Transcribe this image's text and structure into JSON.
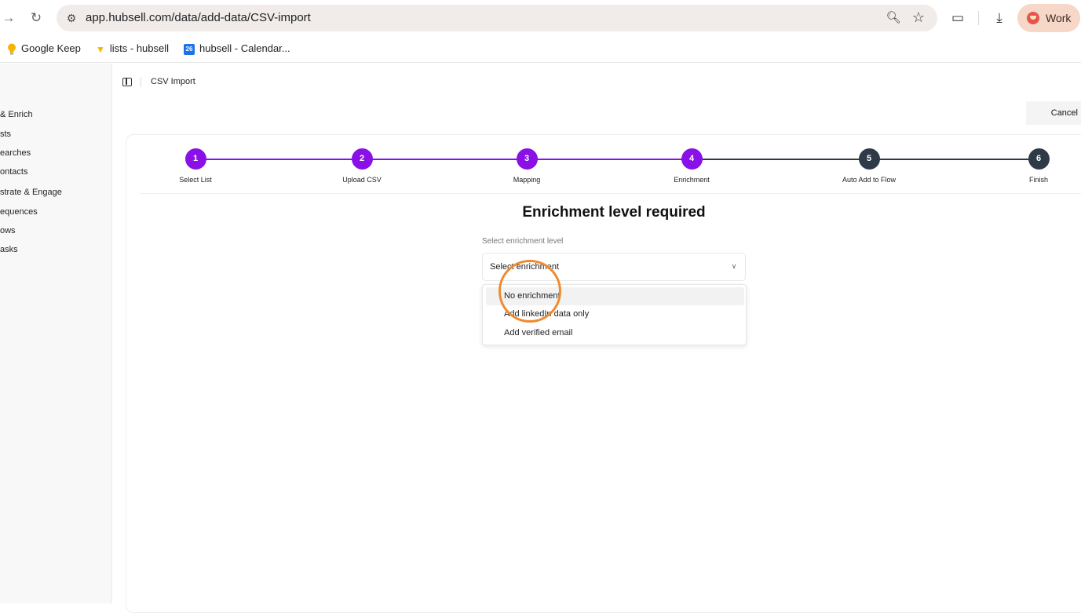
{
  "browser": {
    "url": "app.hubsell.com/data/add-data/CSV-import",
    "profile_label": "Work",
    "icons": {
      "forward": "forward-arrow-icon",
      "reload": "reload-icon",
      "site_settings": "site-settings-icon",
      "zoom": "zoom-icon",
      "bookmark": "star-icon",
      "extensions": "extensions-icon",
      "downloads": "download-icon"
    },
    "bookmarks": [
      {
        "label": "Google Keep",
        "icon": "lightbulb-icon"
      },
      {
        "label": "lists - hubsell",
        "icon": "funnel-icon"
      },
      {
        "label": "hubsell - Calendar...",
        "icon": "calendar-icon",
        "icon_text": "26"
      }
    ]
  },
  "sidebar": {
    "items": [
      {
        "label": "& Enrich"
      },
      {
        "label": "sts"
      },
      {
        "label": "earches"
      },
      {
        "label": "ontacts"
      },
      {
        "label": "strate & Engage"
      },
      {
        "label": "equences"
      },
      {
        "label": "ows"
      },
      {
        "label": "asks"
      }
    ]
  },
  "header": {
    "breadcrumb": "CSV Import",
    "cancel_label": "Cancel"
  },
  "stepper": {
    "steps": [
      {
        "number": "1",
        "label": "Select List",
        "state": "complete"
      },
      {
        "number": "2",
        "label": "Upload CSV",
        "state": "complete"
      },
      {
        "number": "3",
        "label": "Mapping",
        "state": "complete"
      },
      {
        "number": "4",
        "label": "Enrichment",
        "state": "current"
      },
      {
        "number": "5",
        "label": "Auto Add to Flow",
        "state": "pending"
      },
      {
        "number": "6",
        "label": "Finish",
        "state": "pending"
      }
    ],
    "colors": {
      "active": "#8a11e6",
      "pending": "#2f3a48"
    }
  },
  "form": {
    "heading": "Enrichment level required",
    "field_label": "Select enrichment level",
    "select_value": "Select enrichment",
    "options": [
      {
        "label": "No enrichment",
        "highlighted": true
      },
      {
        "label": "Add linkedIn data only",
        "highlighted": false
      },
      {
        "label": "Add verified email",
        "highlighted": false
      }
    ]
  },
  "annotation": {
    "click_indicator_color": "#f08a30"
  }
}
